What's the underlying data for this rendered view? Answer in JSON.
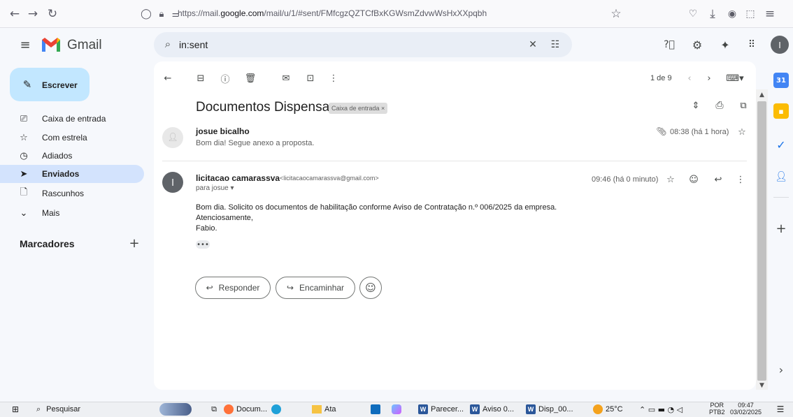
{
  "browser": {
    "url_prefix": "https://mail.",
    "url_domain": "google.com",
    "url_rest": "/mail/u/1/#sent/FMfcgzQZTCfBxKGWsmZdvwWsHxXXpqbh"
  },
  "gmail": {
    "logo_text": "Gmail",
    "search_value": "in:sent",
    "account_initial": "I"
  },
  "sidebar": {
    "compose_label": "Escrever",
    "items": [
      {
        "label": "Caixa de entrada",
        "icon": "inbox-icon"
      },
      {
        "label": "Com estrela",
        "icon": "star-icon"
      },
      {
        "label": "Adiados",
        "icon": "clock-icon"
      },
      {
        "label": "Enviados",
        "icon": "send-icon"
      },
      {
        "label": "Rascunhos",
        "icon": "draft-icon"
      },
      {
        "label": "Mais",
        "icon": "chevron-down-icon"
      }
    ],
    "labels_heading": "Marcadores"
  },
  "toolbar": {
    "pagination": "1 de 9"
  },
  "thread": {
    "subject": "Documentos Dispensa",
    "label_chip": "Caixa de entrada ×",
    "messages": [
      {
        "sender": "josue bicalho",
        "snippet": "Bom dia! Segue anexo a proposta.",
        "time": "08:38 (há 1 hora)"
      },
      {
        "sender": "licitacao camarassva",
        "email": "<licitacaocamarassva@gmail.com>",
        "to": "para josue",
        "time": "09:46 (há 0 minuto)",
        "avatar": "l",
        "body_line1": "Bom dia. Solicito os documentos de habilitação conforme Aviso de Contratação n.º 006/2025 da empresa.",
        "body_line2": "Atenciosamente,",
        "body_line3": "Fabio."
      }
    ],
    "reply_label": "Responder",
    "forward_label": "Encaminhar"
  },
  "taskbar": {
    "search_label": "Pesquisar",
    "apps": [
      "Docum...",
      "Ata",
      "Parecer...",
      "Aviso 0...",
      "Disp_00..."
    ],
    "weather": "25°C",
    "lang_top": "POR",
    "lang_bottom": "PTB2",
    "time": "09:47",
    "date": "03/02/2025"
  },
  "colors": {
    "compose_bg": "#c2e7ff",
    "active_nav_bg": "#d3e3fd",
    "search_bg": "#e9eef6",
    "gmail_red": "#ea4335"
  }
}
